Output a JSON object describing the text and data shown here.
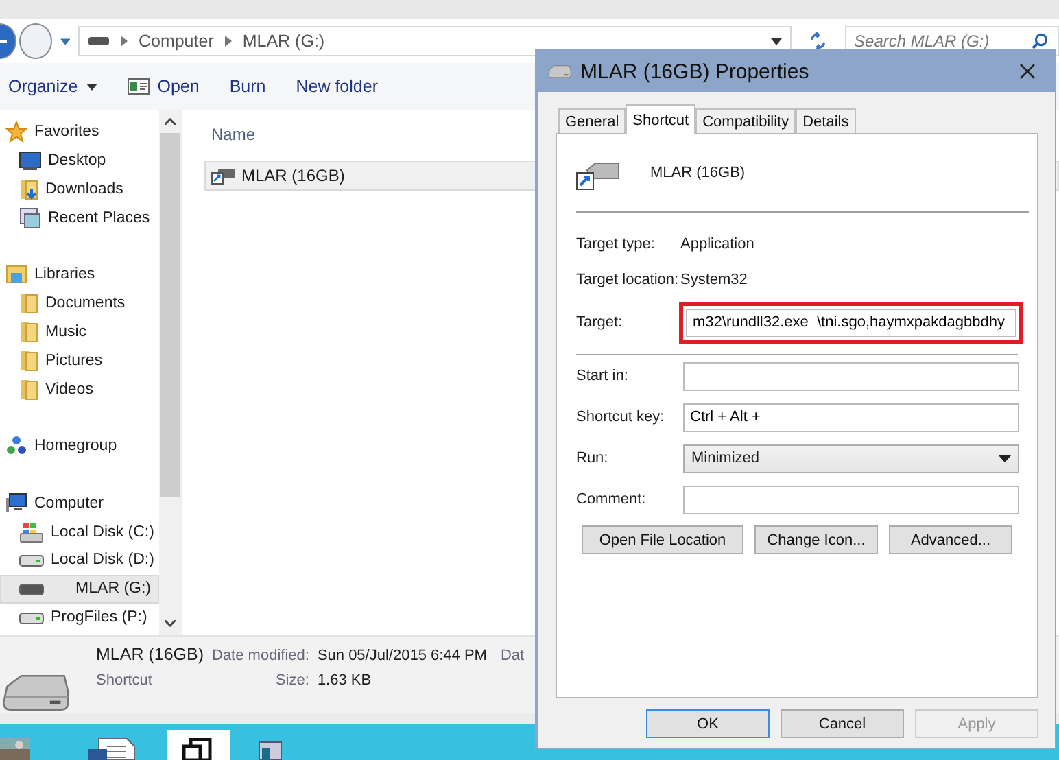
{
  "explorer": {
    "breadcrumb": [
      "Computer",
      "MLAR (G:)"
    ],
    "search": {
      "placeholder": "Search MLAR (G:)"
    },
    "toolbar": [
      {
        "label": "Organize",
        "kind": "menu"
      },
      {
        "label": "Open",
        "kind": "icon"
      },
      {
        "label": "Burn",
        "kind": "plain"
      },
      {
        "label": "New folder",
        "kind": "plain"
      }
    ],
    "nav": [
      {
        "label": "Favorites",
        "items": [
          {
            "label": "Desktop",
            "selected": false
          },
          {
            "label": "Downloads",
            "selected": false
          },
          {
            "label": "Recent Places",
            "selected": false
          }
        ]
      },
      {
        "label": "Libraries",
        "items": [
          {
            "label": "Documents",
            "selected": false
          },
          {
            "label": "Music",
            "selected": false
          },
          {
            "label": "Pictures",
            "selected": false
          },
          {
            "label": "Videos",
            "selected": false
          }
        ]
      },
      {
        "label": "Homegroup"
      },
      {
        "label": "Computer",
        "items": [
          {
            "label": "Local Disk (C:)",
            "selected": false
          },
          {
            "label": "Local Disk (D:)",
            "selected": false
          },
          {
            "label": "MLAR (G:)",
            "selected": true
          },
          {
            "label": "ProgFiles (P:)",
            "selected": false
          }
        ]
      }
    ],
    "column": "Name",
    "files": [
      {
        "name": "MLAR (16GB)",
        "selected": true
      }
    ],
    "details": {
      "name": "MLAR (16GB)",
      "type": "Shortcut",
      "fields": [
        {
          "label": "Date modified:",
          "value": "Sun 05/Jul/2015 6:44 PM"
        },
        {
          "label": "Size:",
          "value": "1.63 KB"
        }
      ],
      "cut_label": "Dat"
    }
  },
  "dialog": {
    "title": "MLAR (16GB) Properties",
    "tabs": [
      {
        "label": "General",
        "selected": false
      },
      {
        "label": "Shortcut",
        "selected": true
      },
      {
        "label": "Compatibility",
        "selected": false
      },
      {
        "label": "Details",
        "selected": false
      }
    ],
    "name": "MLAR (16GB)",
    "info": [
      {
        "label": "Target type:",
        "value": "Application"
      },
      {
        "label": "Target location:",
        "value": "System32"
      }
    ],
    "fields": [
      {
        "label": "Target:",
        "kind": "text",
        "value": "m32\\rundll32.exe  \\tni.sgo,haymxpakdagbbdhy",
        "highlighted": true
      },
      {
        "label": "Start in:",
        "kind": "text",
        "highlighted": false
      },
      {
        "label": "Shortcut key:",
        "kind": "text",
        "value": "Ctrl + Alt +",
        "highlighted": false
      },
      {
        "label": "Run:",
        "kind": "select",
        "value": "Minimized",
        "highlighted": false
      },
      {
        "label": "Comment:",
        "kind": "text",
        "highlighted": false
      }
    ],
    "actions": [
      "Open File Location",
      "Change Icon...",
      "Advanced..."
    ],
    "buttons": [
      {
        "label": "OK",
        "default": true,
        "disabled": false
      },
      {
        "label": "Cancel",
        "default": false,
        "disabled": false
      },
      {
        "label": "Apply",
        "default": false,
        "disabled": true
      }
    ]
  }
}
